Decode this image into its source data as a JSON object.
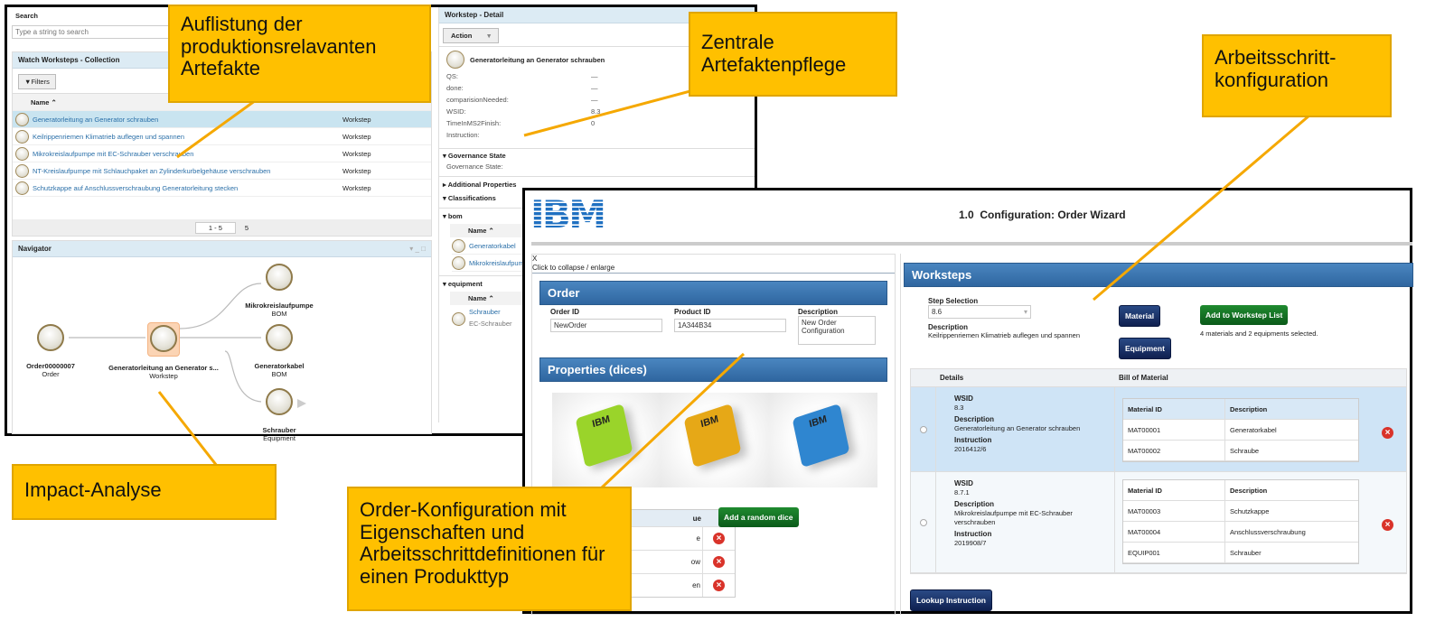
{
  "callouts": {
    "c1": "Auflistung der produktionsrelavanten Artefakte",
    "c2": "Zentrale Artefaktenpflege",
    "c3": "Arbeitsschritt-konfiguration",
    "c4": "Impact-Analyse",
    "c5": "Order-Konfiguration mit Eigenschaften und Arbeitsschrittdefinitionen für einen Produkttyp"
  },
  "colors": {
    "callout": "#ffc000",
    "connector": "#f5a800",
    "panel_header": "#dcebf4",
    "wizard_bar": "#2f66a0",
    "navy_button": "#1a3268",
    "green_button": "#147a25"
  },
  "search": {
    "title": "Search",
    "placeholder": "Type a string to search"
  },
  "collection": {
    "title": "Watch Worksteps - Collection",
    "filters": "Filters",
    "col_name": "Name",
    "rows": [
      {
        "name": "Generatorleitung an Generator schrauben",
        "type": "Workstep"
      },
      {
        "name": "Keilrippenriemen Klimatrieb auflegen und spannen",
        "type": "Workstep"
      },
      {
        "name": "Mikrokreislaufpumpe mit EC-Schrauber verschrauben",
        "type": "Workstep"
      },
      {
        "name": "NT-Kreislaufpumpe mit Schlauchpaket an Zylinderkurbelgehäuse verschrauben",
        "type": "Workstep"
      },
      {
        "name": "Schutzkappe auf Anschlussverschraubung Generatorleitung stecken",
        "type": "Workstep"
      }
    ],
    "paging": "1 - 5",
    "total": "5"
  },
  "navigator": {
    "title": "Navigator",
    "nodes": [
      {
        "name": "Order00000007",
        "type": "Order"
      },
      {
        "name": "Generatorleitung an Generator s...",
        "type": "Workstep"
      },
      {
        "name": "Mikrokreislaufpumpe",
        "type": "BOM"
      },
      {
        "name": "Generatorkabel",
        "type": "BOM"
      },
      {
        "name": "Schrauber",
        "type": "Equipment"
      }
    ]
  },
  "detail": {
    "title": "Workstep - Detail",
    "action": "Action",
    "name": "Generatorleitung an Generator schrauben",
    "fields": [
      {
        "k": "QS:",
        "v": "—"
      },
      {
        "k": "done:",
        "v": "—"
      },
      {
        "k": "comparisionNeeded:",
        "v": "—"
      },
      {
        "k": "WSID:",
        "v": "8.3"
      },
      {
        "k": "TimeInMS2Finish:",
        "v": "0"
      },
      {
        "k": "Instruction:",
        "v": ""
      }
    ],
    "gov": "Governance State",
    "gov_field": "Governance State:",
    "addprops": "Additional Properties",
    "class": "Classifications",
    "bom": "bom",
    "col_name": "Name",
    "bom_items": [
      "Generatorkabel",
      "Mikrokreislaufpump"
    ],
    "equipment": "equipment",
    "equip_items": [
      "Schrauber",
      "EC-Schrauber"
    ]
  },
  "wizard": {
    "logo": "IBM",
    "version": "1.0",
    "title": "Configuration: Order Wizard",
    "close": "X",
    "collapse": "Click to collapse / enlarge",
    "order": {
      "title": "Order",
      "order_id_label": "Order ID",
      "order_id": "NewOrder",
      "product_id_label": "Product ID",
      "product_id": "1A344B34",
      "desc_label": "Description",
      "desc": "New Order Configuration"
    },
    "props": {
      "title": "Properties (dices)",
      "dice_colors": [
        "#9ad42a",
        "#e6a817",
        "#2f86d0"
      ],
      "col_value": "ue",
      "values": [
        "e",
        "ow",
        "en"
      ],
      "add": "Add a random dice"
    },
    "worksteps": {
      "title": "Worksteps",
      "step_label": "Step Selection",
      "step_value": "8.6",
      "desc_label": "Description",
      "desc": "Keilrippenriemen Klimatrieb auflegen und spannen",
      "material": "Material",
      "equipment": "Equipment",
      "add": "Add to Workstep List",
      "selected": "4 materials and 2 equipments selected.",
      "col_details": "Details",
      "col_bom": "Bill of Material",
      "wsid_label": "WSID",
      "desc_lbl": "Description",
      "instr_label": "Instruction",
      "mat_id": "Material ID",
      "mat_desc": "Description",
      "rows": [
        {
          "wsid": "8.3",
          "desc": "Generatorleitung an Generator schrauben",
          "instr": "2016412/6",
          "mats": [
            {
              "id": "MAT00001",
              "d": "Generatorkabel"
            },
            {
              "id": "MAT00002",
              "d": "Schraube"
            }
          ]
        },
        {
          "wsid": "8.7.1",
          "desc": "Mikrokreislaufpumpe mit EC-Schrauber verschrauben",
          "instr": "2019908/7",
          "mats": [
            {
              "id": "MAT00003",
              "d": "Schutzkappe"
            },
            {
              "id": "MAT00004",
              "d": "Anschlussverschraubung"
            },
            {
              "id": "EQUIP001",
              "d": "Schrauber"
            }
          ]
        }
      ],
      "lookup": "Lookup Instruction"
    }
  }
}
